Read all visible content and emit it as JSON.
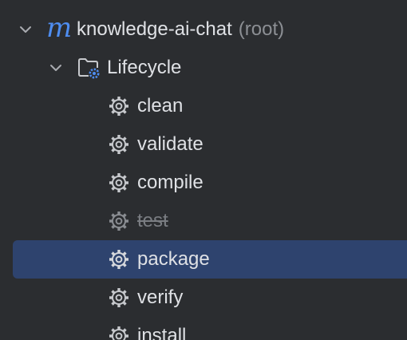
{
  "tree": {
    "root": {
      "label": "knowledge-ai-chat",
      "suffix": "(root)",
      "icon": "maven-module-icon",
      "icon_glyph": "m",
      "expanded": true
    },
    "lifecycle": {
      "label": "Lifecycle",
      "icon": "folder-gear-icon",
      "expanded": true
    },
    "goals": [
      {
        "label": "clean",
        "icon": "gear-icon",
        "state": "normal"
      },
      {
        "label": "validate",
        "icon": "gear-icon",
        "state": "normal"
      },
      {
        "label": "compile",
        "icon": "gear-icon",
        "state": "normal"
      },
      {
        "label": "test",
        "icon": "gear-icon",
        "state": "skipped"
      },
      {
        "label": "package",
        "icon": "gear-icon",
        "state": "selected"
      },
      {
        "label": "verify",
        "icon": "gear-icon",
        "state": "normal"
      },
      {
        "label": "install",
        "icon": "gear-icon",
        "state": "normal"
      }
    ]
  },
  "colors": {
    "background": "#2b2d30",
    "selection": "#2e436e",
    "text": "#dfe1e5",
    "muted": "#8c8f94",
    "accent": "#4e8df0"
  }
}
